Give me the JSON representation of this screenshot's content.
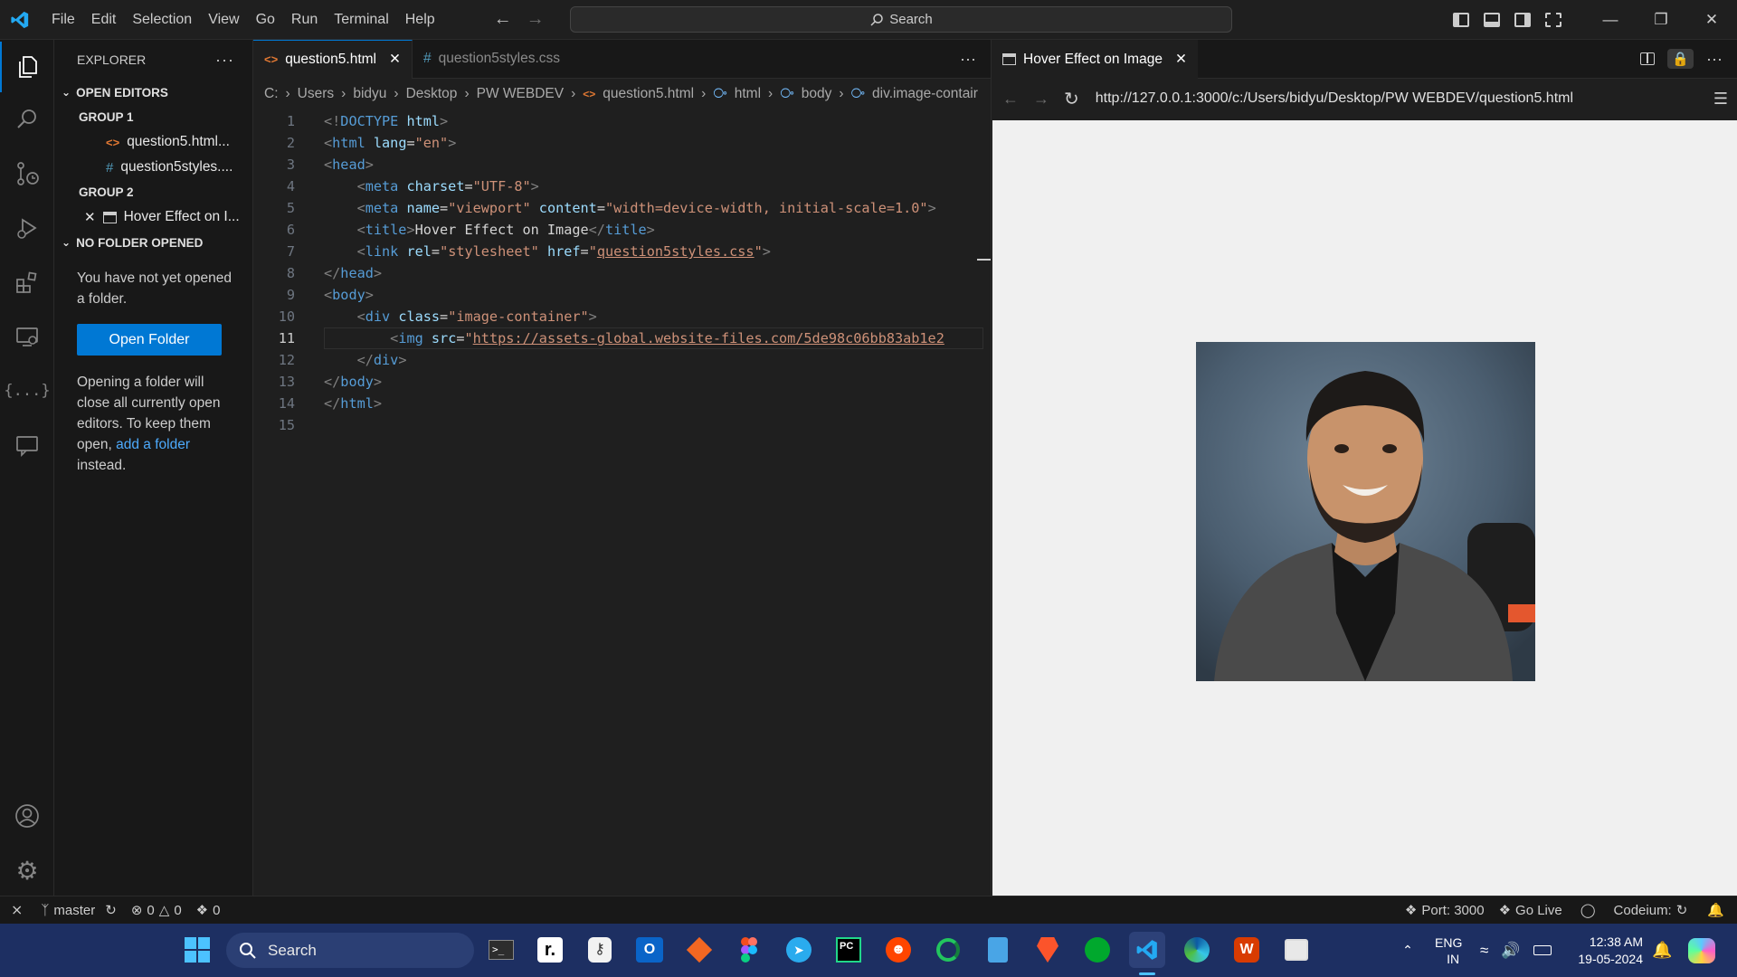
{
  "titlebar": {
    "menu": [
      "File",
      "Edit",
      "Selection",
      "View",
      "Go",
      "Run",
      "Terminal",
      "Help"
    ],
    "search_label": "Search"
  },
  "sidebar": {
    "title": "EXPLORER",
    "open_editors": "OPEN EDITORS",
    "group1": "GROUP 1",
    "group1_files": [
      "question5.html...",
      "question5styles...."
    ],
    "group2": "GROUP 2",
    "group2_file": "Hover Effect on I...",
    "no_folder": "NO FOLDER OPENED",
    "no_folder_text": "You have not yet opened a folder.",
    "open_folder_button": "Open Folder",
    "info_text_1": "Opening a folder will close all currently open editors. To keep them open,",
    "info_link": "add a folder",
    "info_text_2": "instead."
  },
  "editor": {
    "tabs": [
      {
        "label": "question5.html",
        "active": true
      },
      {
        "label": "question5styles.css",
        "active": false
      }
    ],
    "breadcrumb": [
      "C:",
      "Users",
      "bidyu",
      "Desktop",
      "PW WEBDEV",
      "question5.html",
      "html",
      "body",
      "div.image-contair"
    ],
    "current_line": 11
  },
  "preview": {
    "tab_label": "Hover Effect on Image",
    "url": "http://127.0.0.1:3000/c:/Users/bidyu/Desktop/PW WEBDEV/question5.html"
  },
  "statusbar": {
    "branch": "master",
    "errors": "0",
    "warnings": "0",
    "ports": "0",
    "port_label": "Port: 3000",
    "go_live": "Go Live",
    "codeium": "Codeium:"
  },
  "taskbar": {
    "search_label": "Search",
    "lang_1": "ENG",
    "lang_2": "IN",
    "time": "12:38 AM",
    "date": "19-05-2024"
  },
  "colors": {
    "accent": "#0078d4",
    "taskbar": "#1d2f62",
    "preview_bg": "#f0f0f0"
  }
}
